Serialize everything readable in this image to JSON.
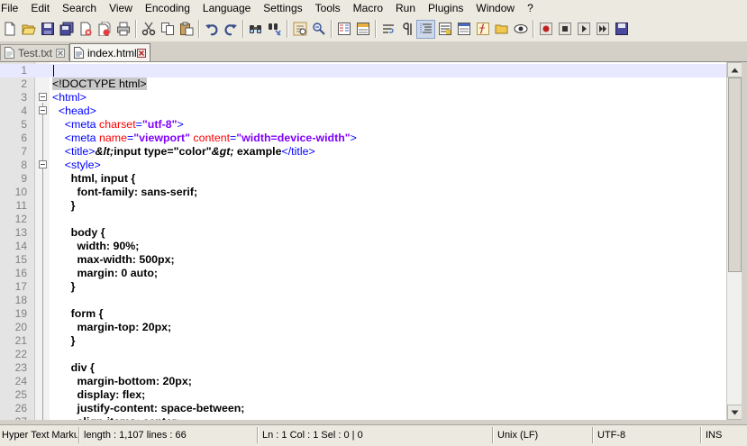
{
  "menu": [
    "File",
    "Edit",
    "Search",
    "View",
    "Encoding",
    "Language",
    "Settings",
    "Tools",
    "Macro",
    "Run",
    "Plugins",
    "Window",
    "?"
  ],
  "tabs": [
    {
      "label": "Test.txt",
      "active": false
    },
    {
      "label": "index.html",
      "active": true
    }
  ],
  "toolbar_icons": [
    "new-file-icon",
    "open-file-icon",
    "save-icon",
    "save-all-icon",
    "close-icon",
    "close-all-icon",
    "print-icon",
    "cut-icon",
    "copy-icon",
    "paste-icon",
    "undo-icon",
    "redo-icon",
    "find-icon",
    "find-replace-icon",
    "zoom-in-icon",
    "zoom-out-icon",
    "sync-vertical-icon",
    "sync-horizontal-icon",
    "word-wrap-icon",
    "show-all-chars-icon",
    "indent-guide-icon",
    "udl-icon",
    "doc-map-icon",
    "function-list-icon",
    "folder-workspace-icon",
    "monitoring-icon",
    "record-macro-icon",
    "stop-record-icon",
    "play-macro-icon",
    "run-macro-multiple-icon",
    "save-macro-icon"
  ],
  "editor": {
    "lines": [
      {
        "n": "1",
        "tokens": []
      },
      {
        "n": "2",
        "tokens": [
          {
            "t": "<!DOCTYPE html>",
            "c": "t-plain t-hl"
          }
        ]
      },
      {
        "n": "3",
        "tokens": [
          {
            "t": "<html>",
            "c": "t-tag"
          }
        ]
      },
      {
        "n": "4",
        "tokens": [
          {
            "t": "  <head>",
            "c": "t-tag"
          }
        ]
      },
      {
        "n": "5",
        "tokens": [
          {
            "t": "    <meta ",
            "c": "t-tag"
          },
          {
            "t": "charset",
            "c": "t-attr"
          },
          {
            "t": "=",
            "c": "t-tag"
          },
          {
            "t": "\"utf-8\"",
            "c": "t-val"
          },
          {
            "t": ">",
            "c": "t-tag"
          }
        ]
      },
      {
        "n": "6",
        "tokens": [
          {
            "t": "    <meta ",
            "c": "t-tag"
          },
          {
            "t": "name",
            "c": "t-attr"
          },
          {
            "t": "=",
            "c": "t-tag"
          },
          {
            "t": "\"viewport\"",
            "c": "t-val"
          },
          {
            "t": " content",
            "c": "t-attr"
          },
          {
            "t": "=",
            "c": "t-tag"
          },
          {
            "t": "\"width=device-width\"",
            "c": "t-val"
          },
          {
            "t": ">",
            "c": "t-tag"
          }
        ]
      },
      {
        "n": "7",
        "tokens": [
          {
            "t": "    <title>",
            "c": "t-tag"
          },
          {
            "t": "&lt;",
            "c": "t-ent"
          },
          {
            "t": "input type=\"color\"",
            "c": "t-bold"
          },
          {
            "t": "&gt;",
            "c": "t-ent"
          },
          {
            "t": " example",
            "c": "t-bold"
          },
          {
            "t": "</title>",
            "c": "t-tag"
          }
        ]
      },
      {
        "n": "8",
        "tokens": [
          {
            "t": "    <style>",
            "c": "t-tag"
          }
        ]
      },
      {
        "n": "9",
        "tokens": [
          {
            "t": "      html, input {",
            "c": "t-bold"
          }
        ]
      },
      {
        "n": "10",
        "tokens": [
          {
            "t": "        font-family: sans-serif;",
            "c": "t-bold"
          }
        ]
      },
      {
        "n": "11",
        "tokens": [
          {
            "t": "      }",
            "c": "t-bold"
          }
        ]
      },
      {
        "n": "12",
        "tokens": []
      },
      {
        "n": "13",
        "tokens": [
          {
            "t": "      body {",
            "c": "t-bold"
          }
        ]
      },
      {
        "n": "14",
        "tokens": [
          {
            "t": "        width: 90%;",
            "c": "t-bold"
          }
        ]
      },
      {
        "n": "15",
        "tokens": [
          {
            "t": "        max-width: 500px;",
            "c": "t-bold"
          }
        ]
      },
      {
        "n": "16",
        "tokens": [
          {
            "t": "        margin: 0 auto;",
            "c": "t-bold"
          }
        ]
      },
      {
        "n": "17",
        "tokens": [
          {
            "t": "      }",
            "c": "t-bold"
          }
        ]
      },
      {
        "n": "18",
        "tokens": []
      },
      {
        "n": "19",
        "tokens": [
          {
            "t": "      form {",
            "c": "t-bold"
          }
        ]
      },
      {
        "n": "20",
        "tokens": [
          {
            "t": "        margin-top: 20px;",
            "c": "t-bold"
          }
        ]
      },
      {
        "n": "21",
        "tokens": [
          {
            "t": "      }",
            "c": "t-bold"
          }
        ]
      },
      {
        "n": "22",
        "tokens": []
      },
      {
        "n": "23",
        "tokens": [
          {
            "t": "      div {",
            "c": "t-bold"
          }
        ]
      },
      {
        "n": "24",
        "tokens": [
          {
            "t": "        margin-bottom: 20px;",
            "c": "t-bold"
          }
        ]
      },
      {
        "n": "25",
        "tokens": [
          {
            "t": "        display: flex;",
            "c": "t-bold"
          }
        ]
      },
      {
        "n": "26",
        "tokens": [
          {
            "t": "        justify-content: space-between;",
            "c": "t-bold"
          }
        ]
      },
      {
        "n": "27",
        "tokens": [
          {
            "t": "        align-items: center;",
            "c": "t-bold"
          }
        ]
      }
    ]
  },
  "status": {
    "language": "Hyper Text Markup Language file",
    "length_lines": "length : 1,107    lines : 66",
    "position": "Ln : 1    Col : 1    Sel : 0 | 0",
    "eol": "Unix (LF)",
    "encoding": "UTF-8",
    "mode": "INS"
  },
  "colors": {
    "tag": "#0000ff",
    "attribute": "#ff0000",
    "attr_value": "#8000ff",
    "current_line": "#e8e8ff",
    "gutter": "#e4e4e4",
    "chrome": "#ece9e0"
  }
}
